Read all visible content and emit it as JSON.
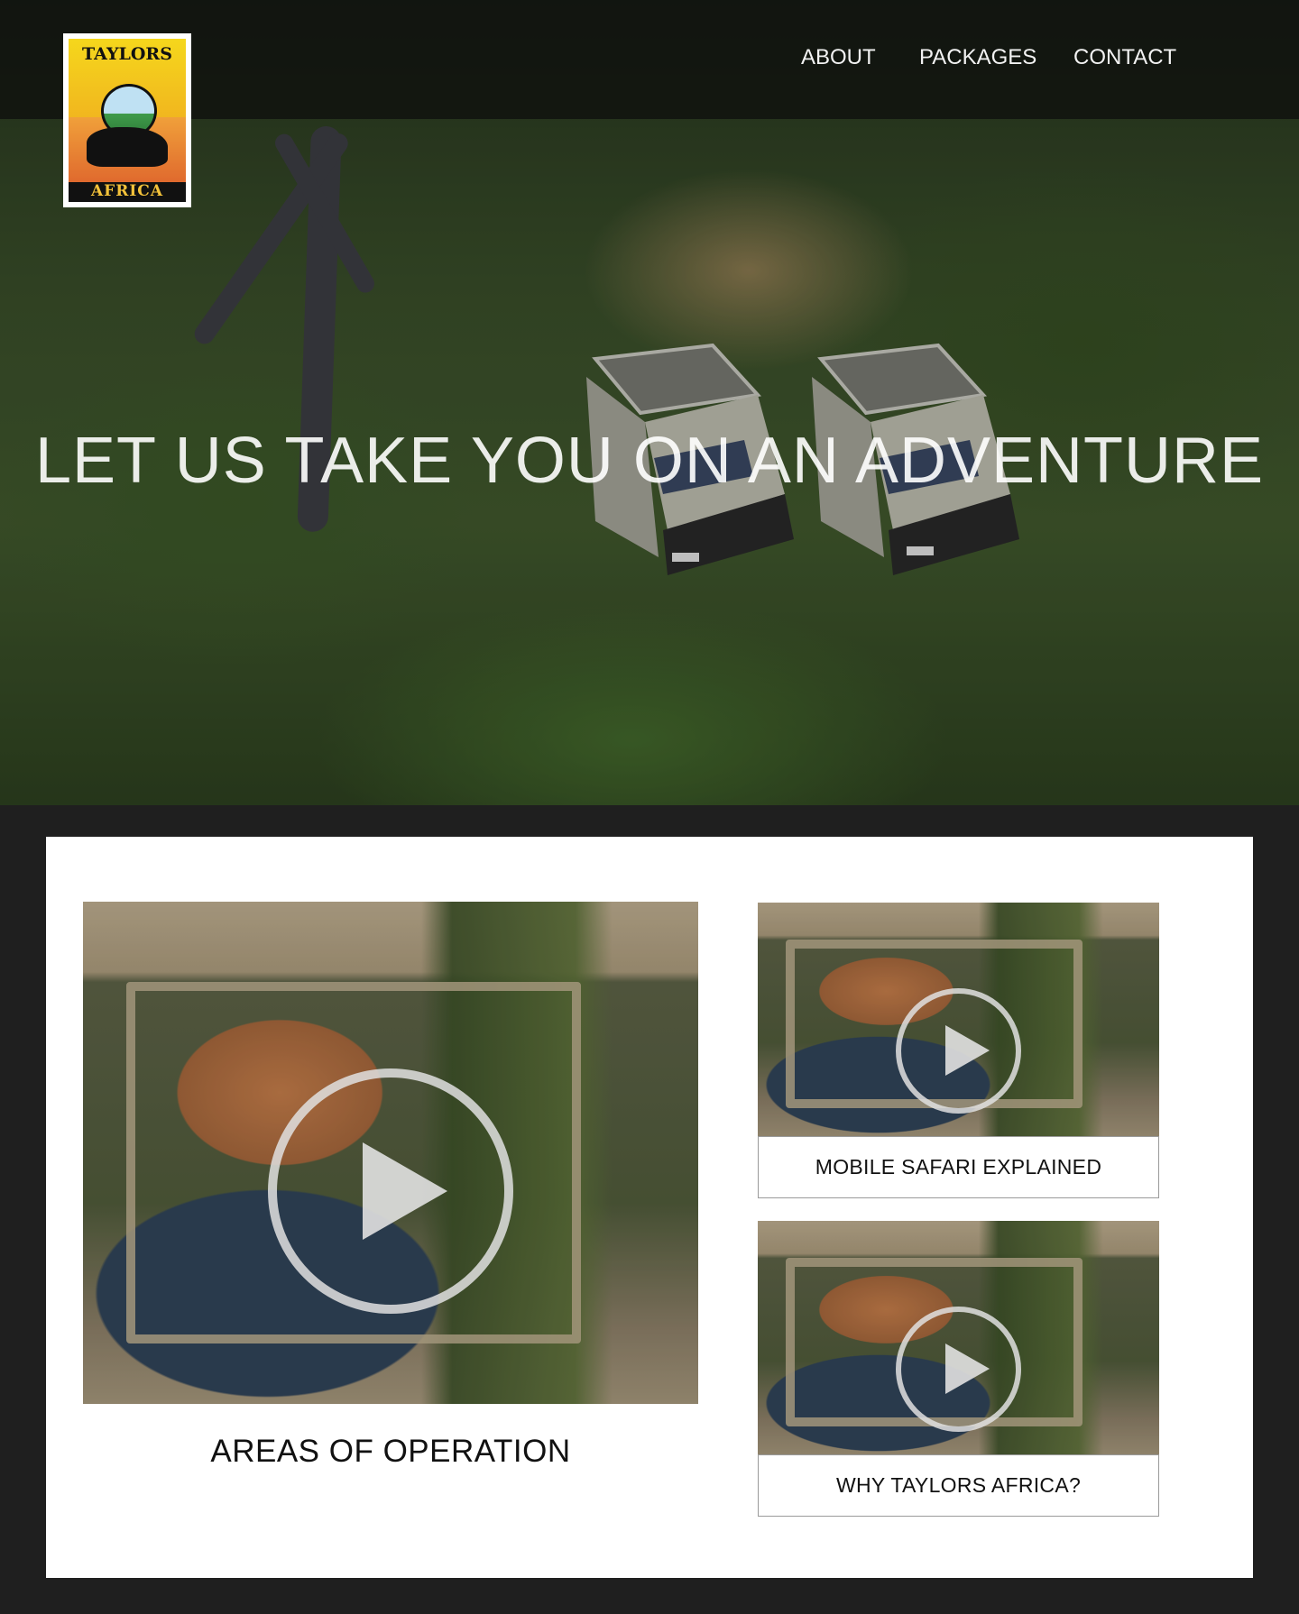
{
  "brand": {
    "logo_top_text": "TAYLORS",
    "logo_bottom_text": "AFRICA"
  },
  "nav": {
    "items": [
      {
        "label": "ABOUT"
      },
      {
        "label": "PACKAGES"
      },
      {
        "label": "CONTACT"
      }
    ]
  },
  "hero": {
    "headline": "LET US TAKE YOU ON AN ADVENTURE"
  },
  "videos": {
    "main": {
      "caption": "AREAS OF OPERATION"
    },
    "side": [
      {
        "caption": "MOBILE SAFARI EXPLAINED"
      },
      {
        "caption": "WHY TAYLORS AFRICA?"
      }
    ]
  },
  "colors": {
    "page_background": "#1f1f1f",
    "content_background": "#ffffff",
    "nav_text": "#f2f2f2"
  }
}
